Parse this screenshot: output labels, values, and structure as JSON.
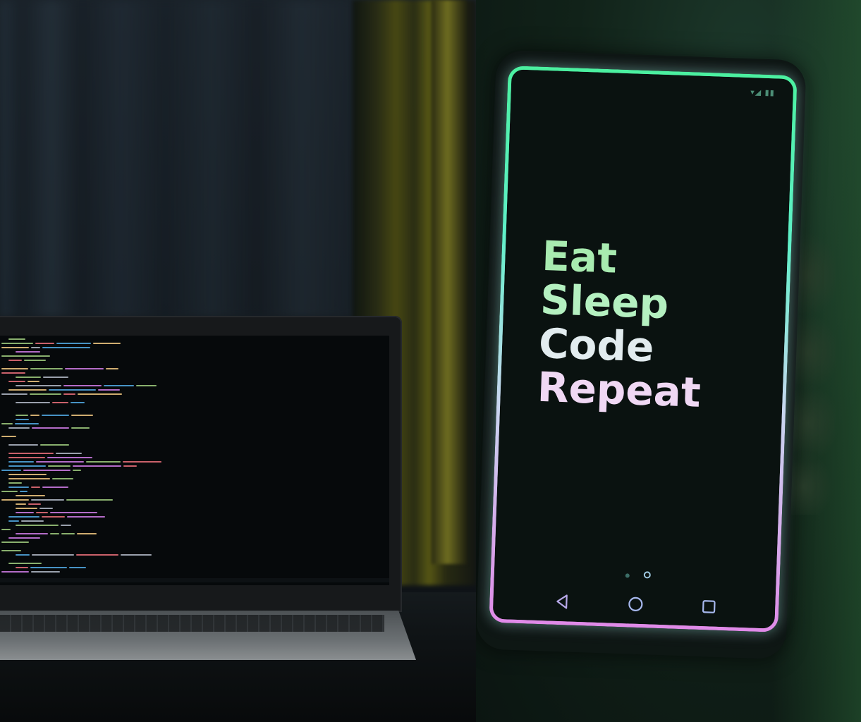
{
  "phone": {
    "slogan": [
      "Eat",
      "Sleep",
      "Code",
      "Repeat"
    ],
    "status_icons": "▾◢ ▮▮",
    "nav_buttons": [
      "back-icon",
      "home-icon",
      "recents-icon"
    ],
    "page_indicator": {
      "pages": 2,
      "current": 2
    },
    "colors": {
      "frame_top": "#4bf0a0",
      "frame_bottom": "#e08ae8",
      "text_top": "#a8ebb0",
      "text_bottom": "#f0d8f4"
    }
  },
  "laptop": {
    "screen_content": "code-editor",
    "syntax_colors": [
      "#4fa3d9",
      "#e5c07b",
      "#98c379",
      "#c678dd",
      "#e06c75",
      "#abb2bf"
    ]
  }
}
